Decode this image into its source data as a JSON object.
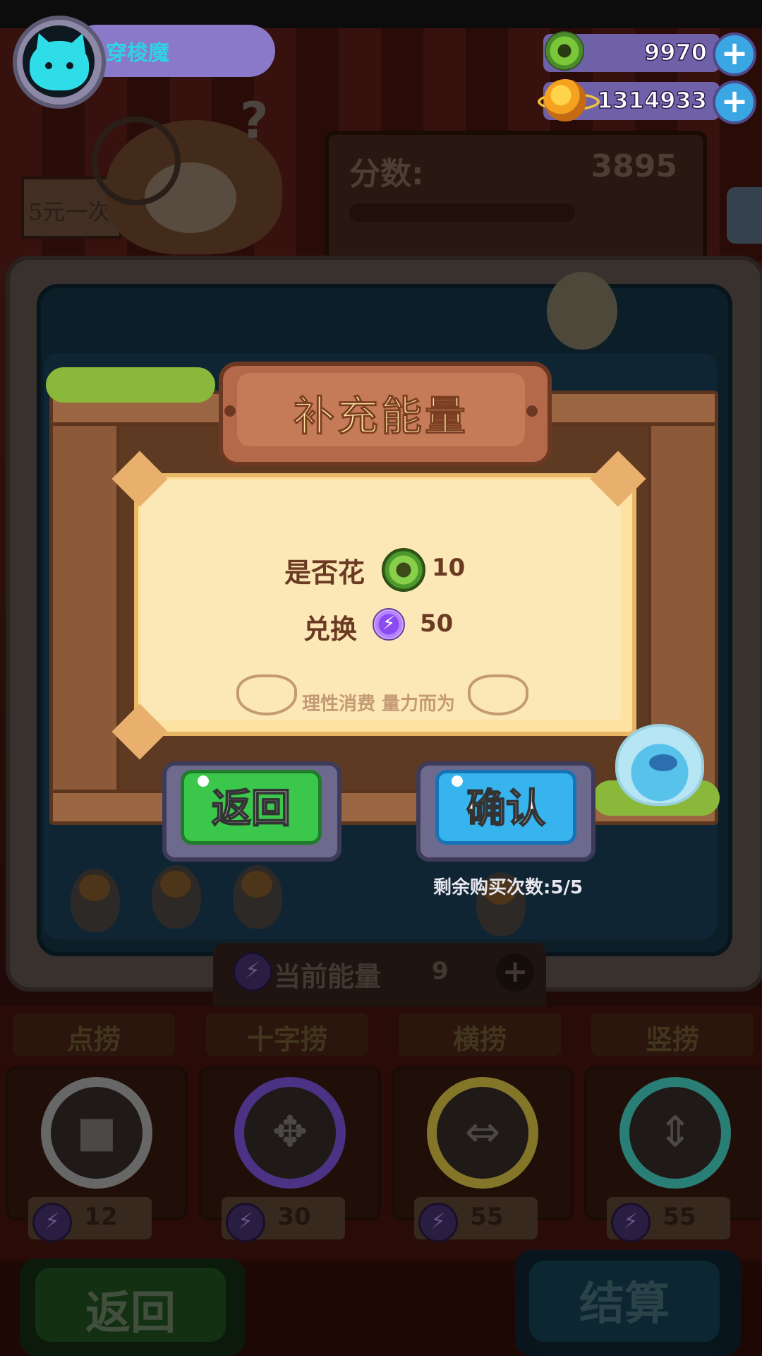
{
  "player": {
    "name": "穿梭魔"
  },
  "currency": {
    "gems": "9970",
    "coins": "1314933"
  },
  "scoreboard": {
    "label": "分数:",
    "value": "3895"
  },
  "sign_text": "5元一次",
  "dialog": {
    "title": "补充能量",
    "line1_prefix": "是否花",
    "line1_amount": "10",
    "line2_prefix": "兑换",
    "line2_amount": "50",
    "hint": "理性消费 量力而为",
    "back_label": "返回",
    "confirm_label": "确认",
    "remaining": "剩余购买次数:5/5"
  },
  "energy": {
    "label": "当前能量",
    "value": "9"
  },
  "tools": [
    {
      "name": "点捞",
      "cost": "12",
      "ring_color": "#8f8f8f",
      "arrows": "■"
    },
    {
      "name": "十字捞",
      "cost": "30",
      "ring_color": "#6a46b8",
      "arrows": "✥"
    },
    {
      "name": "横捞",
      "cost": "55",
      "ring_color": "#b8a43a",
      "arrows": "⇔"
    },
    {
      "name": "竖捞",
      "cost": "55",
      "ring_color": "#3ab0a4",
      "arrows": "⇕"
    }
  ],
  "bottom": {
    "back_label": "返回",
    "settle_label": "结算"
  },
  "icons": {
    "gem": "green-donut-coin-icon",
    "coin": "orange-planet-coin-icon",
    "energy": "lightning-bolt-icon",
    "plus": "plus-icon"
  },
  "colors": {
    "confirm": "#37b3ee",
    "back": "#3bc74b",
    "title_plate": "#b4694a",
    "paper": "#fce8b6"
  }
}
